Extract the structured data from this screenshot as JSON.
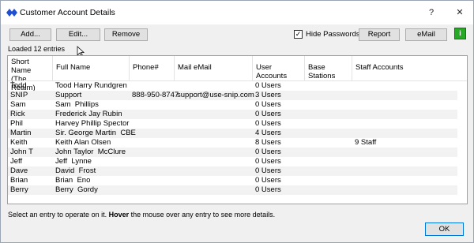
{
  "window": {
    "title": "Customer Account Details",
    "help_glyph": "?",
    "close_glyph": "✕"
  },
  "toolbar": {
    "add_label": "Add...",
    "edit_label": "Edit...",
    "remove_label": "Remove",
    "hide_passwords_label": "Hide Passwords",
    "hide_passwords_checked": true,
    "report_label": "Report",
    "email_label": "eMail",
    "green_button_label": "i"
  },
  "status": {
    "loaded": "Loaded 12 entries"
  },
  "table": {
    "columns": [
      "Short Name\n(The Realm)",
      "Full Name",
      "Phone#",
      "Mail eMail",
      "User Accounts",
      "Base Stations",
      "Staff Accounts"
    ],
    "rows": [
      [
        "Todd",
        "Tood Harry Rundgren",
        "",
        "",
        "0 Users",
        "",
        ""
      ],
      [
        "SNIP",
        "Support",
        "888-950-8747",
        "support@use-snip.com",
        "3 Users",
        "",
        ""
      ],
      [
        "Sam",
        "Sam  Phillips",
        "",
        "",
        "0 Users",
        "",
        ""
      ],
      [
        "Rick",
        "Frederick Jay Rubin",
        "",
        "",
        "0 Users",
        "",
        ""
      ],
      [
        "Phil",
        "Harvey Phillip Spector",
        "",
        "",
        "0 Users",
        "",
        ""
      ],
      [
        "Martin",
        "Sir. George Martin  CBE",
        "",
        "",
        "4 Users",
        "",
        ""
      ],
      [
        "Keith",
        "Keith Alan Olsen",
        "",
        "",
        "8 Users",
        "",
        "9 Staff"
      ],
      [
        "John T",
        "John Taylor  McClure",
        "",
        "",
        "0 Users",
        "",
        ""
      ],
      [
        "Jeff",
        "Jeff  Lynne",
        "",
        "",
        "0 Users",
        "",
        ""
      ],
      [
        "Dave",
        "David  Frost",
        "",
        "",
        "0 Users",
        "",
        ""
      ],
      [
        "Brian",
        "Brian  Eno",
        "",
        "",
        "0 Users",
        "",
        ""
      ],
      [
        "Berry",
        "Berry  Gordy",
        "",
        "",
        "0 Users",
        "",
        ""
      ]
    ]
  },
  "footer": {
    "hint_prefix": "Select an entry to operate on it. ",
    "hint_bold": "Hover",
    "hint_suffix": " the mouse over any entry to see more details.",
    "ok_label": "OK"
  },
  "colors": {
    "app_icon": "#1f4fd1",
    "green_button": "#27a827",
    "alt_row": "#f2f2f2"
  }
}
